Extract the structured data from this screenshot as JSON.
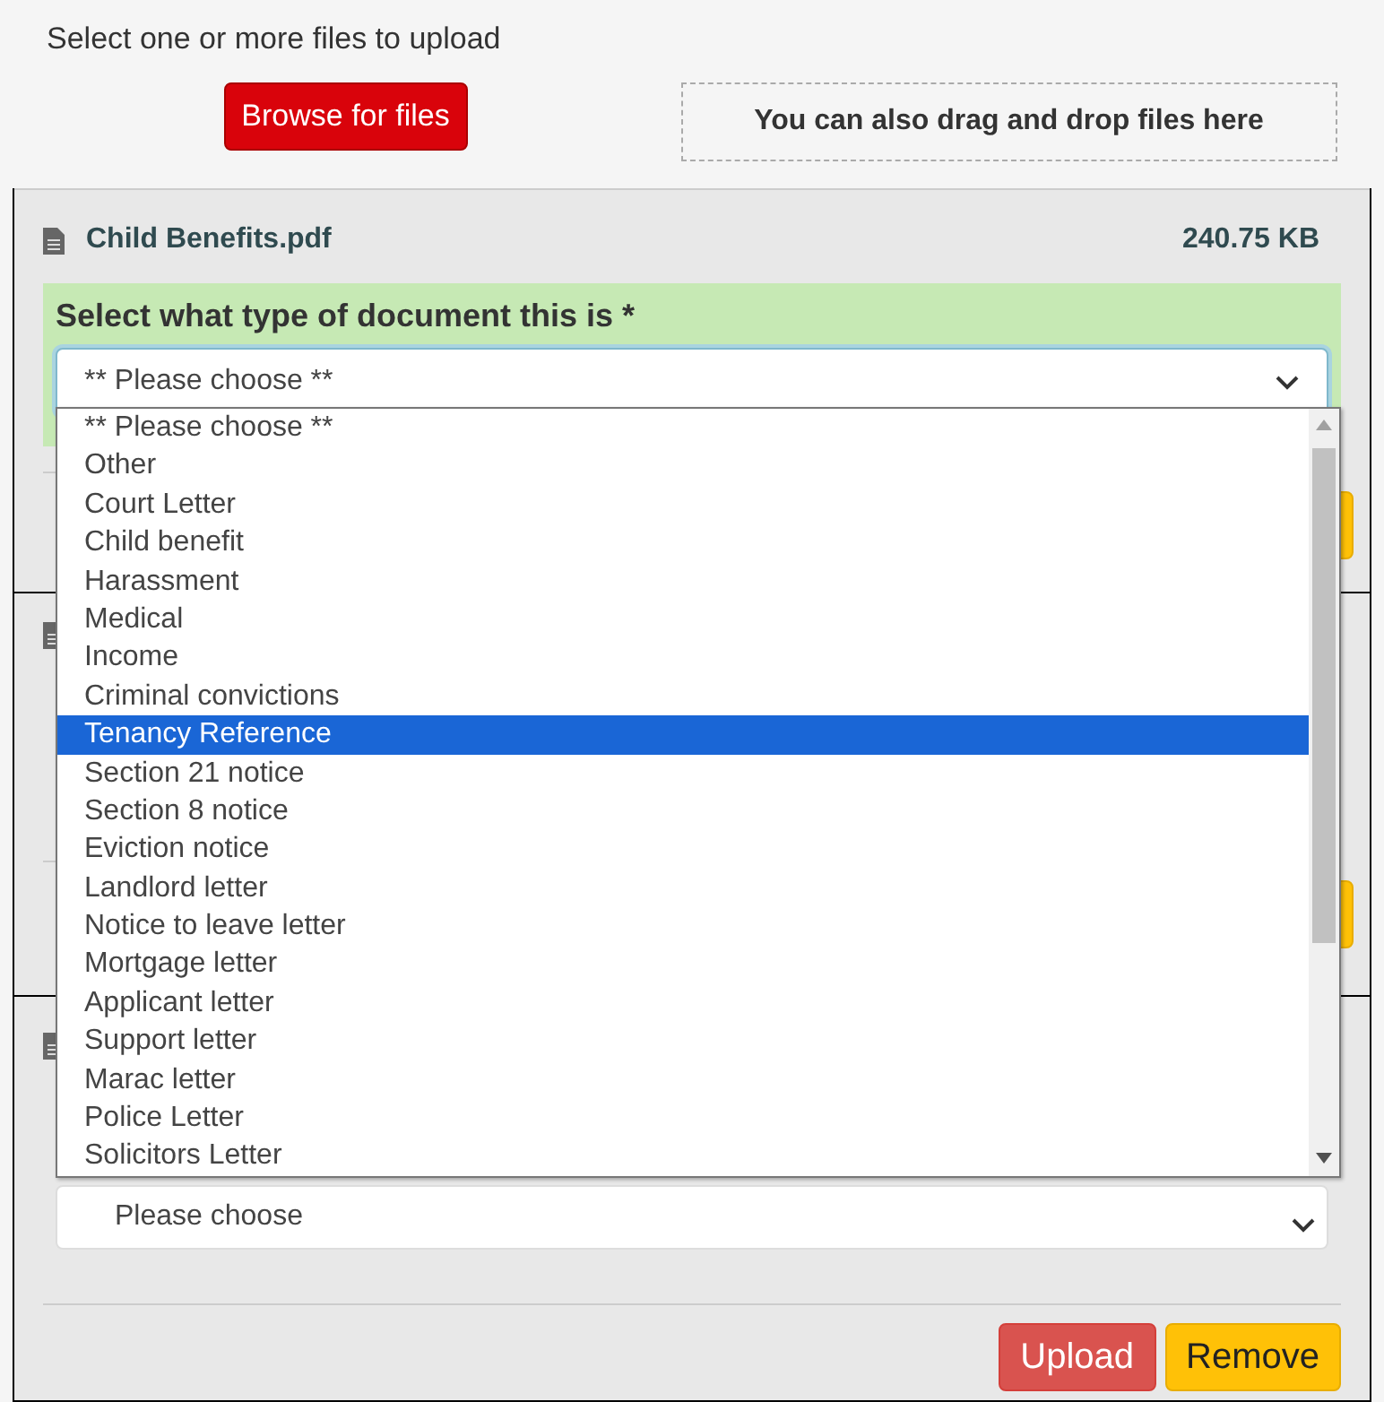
{
  "header": {
    "prompt": "Select one or more files to upload",
    "browse_button": "Browse for files",
    "drop_zone": "You can also drag and drop files here"
  },
  "files": [
    {
      "kind": "open",
      "name": "Child Benefits.pdf",
      "size": "240.75 KB",
      "type_label": "Select what type of document this is *",
      "select_value": "** Please choose **"
    },
    {
      "kind": "covered"
    },
    {
      "kind": "covered_end",
      "select_value": "Please choose",
      "actions": [
        {
          "label": "Upload",
          "kind": "danger"
        },
        {
          "label": "Remove",
          "kind": "warning"
        }
      ]
    }
  ],
  "dropdown": {
    "options": [
      {
        "label": "** Please choose **",
        "selected": false
      },
      {
        "label": "Other",
        "selected": false
      },
      {
        "label": "Court Letter",
        "selected": false
      },
      {
        "label": "Child benefit",
        "selected": false
      },
      {
        "label": "Harassment",
        "selected": false
      },
      {
        "label": "Medical",
        "selected": false
      },
      {
        "label": "Income",
        "selected": false
      },
      {
        "label": "Criminal convictions",
        "selected": false
      },
      {
        "label": "Tenancy Reference",
        "selected": true
      },
      {
        "label": "Section 21 notice",
        "selected": false
      },
      {
        "label": "Section 8 notice",
        "selected": false
      },
      {
        "label": "Eviction notice",
        "selected": false
      },
      {
        "label": "Landlord letter",
        "selected": false
      },
      {
        "label": "Notice to leave letter",
        "selected": false
      },
      {
        "label": "Mortgage letter",
        "selected": false
      },
      {
        "label": "Applicant letter",
        "selected": false
      },
      {
        "label": "Support letter",
        "selected": false
      },
      {
        "label": "Marac letter",
        "selected": false
      },
      {
        "label": "Police Letter",
        "selected": false
      },
      {
        "label": "Solicitors Letter",
        "selected": false
      }
    ]
  }
}
